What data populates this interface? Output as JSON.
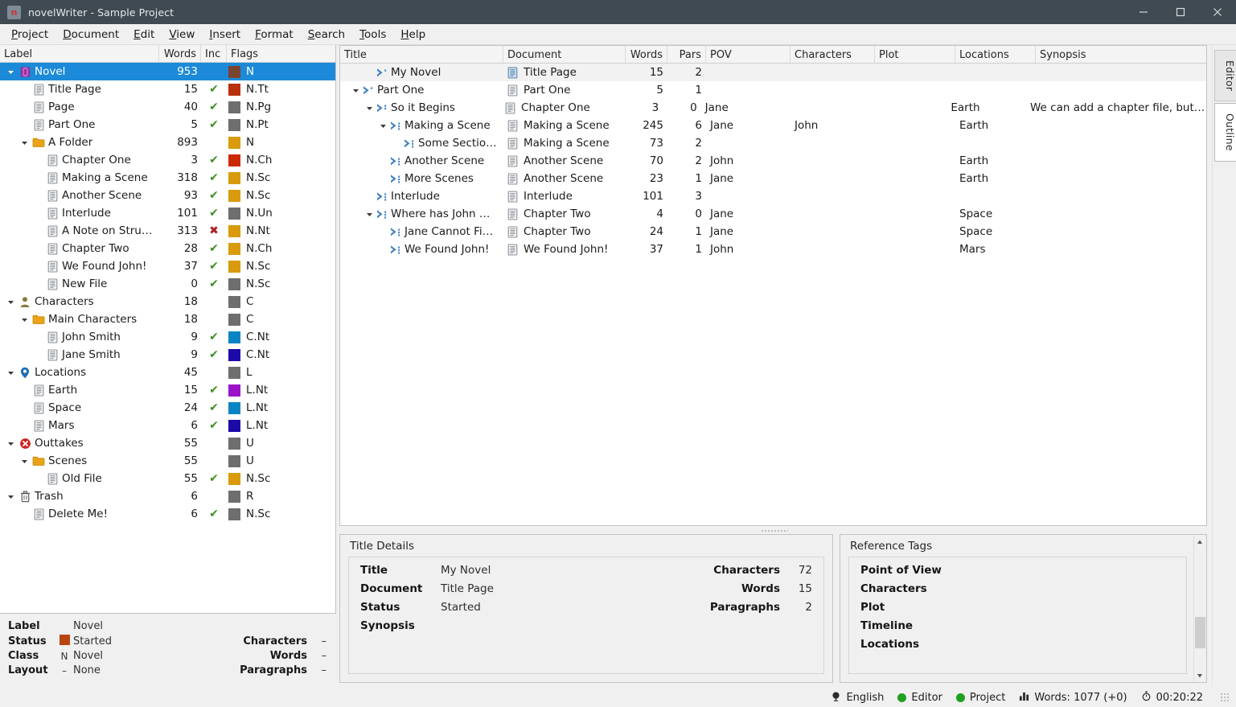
{
  "window": {
    "title": "novelWriter - Sample Project",
    "app_icon": "novelwriter-logo-icon",
    "minimize": "−",
    "maximize": "□",
    "close": "✕"
  },
  "menubar": {
    "items": [
      {
        "label": "Project",
        "mnemonic": "P"
      },
      {
        "label": "Document",
        "mnemonic": "D"
      },
      {
        "label": "Edit",
        "mnemonic": "E"
      },
      {
        "label": "View",
        "mnemonic": "V"
      },
      {
        "label": "Insert",
        "mnemonic": "I"
      },
      {
        "label": "Format",
        "mnemonic": "F"
      },
      {
        "label": "Search",
        "mnemonic": "S"
      },
      {
        "label": "Tools",
        "mnemonic": "T"
      },
      {
        "label": "Help",
        "mnemonic": "H"
      }
    ]
  },
  "project_tree": {
    "columns": [
      "Label",
      "Words",
      "Inc",
      "Flags"
    ],
    "rows": [
      {
        "label": "Novel",
        "words": "953",
        "inc": "",
        "flag_color": "#7a4530",
        "flags": "N",
        "depth": 0,
        "icon": "book-icon",
        "twisty": "open",
        "selected": true
      },
      {
        "label": "Title Page",
        "words": "15",
        "inc": "✔",
        "flag_color": "#b8300b",
        "flags": "N.Tt",
        "depth": 1,
        "icon": "document-icon",
        "twisty": "none"
      },
      {
        "label": "Page",
        "words": "40",
        "inc": "✔",
        "flag_color": "#6e6e6e",
        "flags": "N.Pg",
        "depth": 1,
        "icon": "document-icon",
        "twisty": "none"
      },
      {
        "label": "Part One",
        "words": "5",
        "inc": "✔",
        "flag_color": "#6e6e6e",
        "flags": "N.Pt",
        "depth": 1,
        "icon": "document-icon",
        "twisty": "none"
      },
      {
        "label": "A Folder",
        "words": "893",
        "inc": "",
        "flag_color": "#d99b0c",
        "flags": "N",
        "depth": 1,
        "icon": "folder-icon",
        "twisty": "open"
      },
      {
        "label": "Chapter One",
        "words": "3",
        "inc": "✔",
        "flag_color": "#cc2a06",
        "flags": "N.Ch",
        "depth": 2,
        "icon": "document-icon",
        "twisty": "none"
      },
      {
        "label": "Making a Scene",
        "words": "318",
        "inc": "✔",
        "flag_color": "#d99b0c",
        "flags": "N.Sc",
        "depth": 2,
        "icon": "document-icon",
        "twisty": "none"
      },
      {
        "label": "Another Scene",
        "words": "93",
        "inc": "✔",
        "flag_color": "#d99b0c",
        "flags": "N.Sc",
        "depth": 2,
        "icon": "document-icon",
        "twisty": "none"
      },
      {
        "label": "Interlude",
        "words": "101",
        "inc": "✔",
        "flag_color": "#6e6e6e",
        "flags": "N.Un",
        "depth": 2,
        "icon": "document-icon",
        "twisty": "none"
      },
      {
        "label": "A Note on Stru…",
        "words": "313",
        "inc": "✖",
        "flag_color": "#d99b0c",
        "flags": "N.Nt",
        "depth": 2,
        "icon": "document-icon",
        "twisty": "none"
      },
      {
        "label": "Chapter Two",
        "words": "28",
        "inc": "✔",
        "flag_color": "#d99b0c",
        "flags": "N.Ch",
        "depth": 2,
        "icon": "document-icon",
        "twisty": "none"
      },
      {
        "label": "We Found John!",
        "words": "37",
        "inc": "✔",
        "flag_color": "#d99b0c",
        "flags": "N.Sc",
        "depth": 2,
        "icon": "document-icon",
        "twisty": "none"
      },
      {
        "label": "New File",
        "words": "0",
        "inc": "✔",
        "flag_color": "#6e6e6e",
        "flags": "N.Sc",
        "depth": 2,
        "icon": "document-icon",
        "twisty": "none"
      },
      {
        "label": "Characters",
        "words": "18",
        "inc": "",
        "flag_color": "#6e6e6e",
        "flags": "C",
        "depth": 0,
        "icon": "person-icon",
        "twisty": "open"
      },
      {
        "label": "Main Characters",
        "words": "18",
        "inc": "",
        "flag_color": "#6e6e6e",
        "flags": "C",
        "depth": 1,
        "icon": "folder-icon",
        "twisty": "open"
      },
      {
        "label": "John Smith",
        "words": "9",
        "inc": "✔",
        "flag_color": "#0a85c4",
        "flags": "C.Nt",
        "depth": 2,
        "icon": "document-icon",
        "twisty": "none"
      },
      {
        "label": "Jane Smith",
        "words": "9",
        "inc": "✔",
        "flag_color": "#1c09a8",
        "flags": "C.Nt",
        "depth": 2,
        "icon": "document-icon",
        "twisty": "none"
      },
      {
        "label": "Locations",
        "words": "45",
        "inc": "",
        "flag_color": "#6e6e6e",
        "flags": "L",
        "depth": 0,
        "icon": "pin-icon",
        "twisty": "open"
      },
      {
        "label": "Earth",
        "words": "15",
        "inc": "✔",
        "flag_color": "#9b13c9",
        "flags": "L.Nt",
        "depth": 1,
        "icon": "document-icon",
        "twisty": "none"
      },
      {
        "label": "Space",
        "words": "24",
        "inc": "✔",
        "flag_color": "#0a85c4",
        "flags": "L.Nt",
        "depth": 1,
        "icon": "document-icon",
        "twisty": "none"
      },
      {
        "label": "Mars",
        "words": "6",
        "inc": "✔",
        "flag_color": "#1c09a8",
        "flags": "L.Nt",
        "depth": 1,
        "icon": "document-icon",
        "twisty": "none"
      },
      {
        "label": "Outtakes",
        "words": "55",
        "inc": "",
        "flag_color": "#6e6e6e",
        "flags": "U",
        "depth": 0,
        "icon": "error-circle-icon",
        "twisty": "open"
      },
      {
        "label": "Scenes",
        "words": "55",
        "inc": "",
        "flag_color": "#6e6e6e",
        "flags": "U",
        "depth": 1,
        "icon": "folder-icon",
        "twisty": "open"
      },
      {
        "label": "Old File",
        "words": "55",
        "inc": "✔",
        "flag_color": "#d99b0c",
        "flags": "N.Sc",
        "depth": 2,
        "icon": "document-icon",
        "twisty": "none"
      },
      {
        "label": "Trash",
        "words": "6",
        "inc": "",
        "flag_color": "#6e6e6e",
        "flags": "R",
        "depth": 0,
        "icon": "trash-icon",
        "twisty": "open"
      },
      {
        "label": "Delete Me!",
        "words": "6",
        "inc": "✔",
        "flag_color": "#6e6e6e",
        "flags": "N.Sc",
        "depth": 1,
        "icon": "document-icon",
        "twisty": "none"
      }
    ]
  },
  "item_details": {
    "label_key": "Label",
    "label_value": "Novel",
    "status_key": "Status",
    "status_value": "Started",
    "status_color": "#b8450f",
    "class_key": "Class",
    "class_mark": "N",
    "class_value": "Novel",
    "layout_key": "Layout",
    "layout_mark": "–",
    "layout_value": "None",
    "characters_key": "Characters",
    "characters_value": "–",
    "words_key": "Words",
    "words_value": "–",
    "paragraphs_key": "Paragraphs",
    "paragraphs_value": "–"
  },
  "outline": {
    "columns": [
      "Title",
      "Document",
      "Words",
      "Pars",
      "POV",
      "Characters",
      "Plot",
      "Locations",
      "Synopsis"
    ],
    "rows": [
      {
        "title": "My Novel",
        "level": 1,
        "depth": 1,
        "twisty": "none",
        "document": "Title Page",
        "words": "15",
        "pars": "2",
        "pov": "",
        "characters": "",
        "plot": "",
        "locations": "",
        "synopsis": "",
        "current": true
      },
      {
        "title": "Part One",
        "level": 1,
        "depth": 0,
        "twisty": "open",
        "document": "Part One",
        "words": "5",
        "pars": "1",
        "pov": "",
        "characters": "",
        "plot": "",
        "locations": "",
        "synopsis": ""
      },
      {
        "title": "So it Begins",
        "level": 2,
        "depth": 1,
        "twisty": "open",
        "document": "Chapter One",
        "words": "3",
        "pars": "0",
        "pov": "Jane",
        "characters": "",
        "plot": "",
        "locations": "Earth",
        "synopsis": "We can add a chapter file, but…"
      },
      {
        "title": "Making a Scene",
        "level": 3,
        "depth": 2,
        "twisty": "open",
        "document": "Making a Scene",
        "words": "245",
        "pars": "6",
        "pov": "Jane",
        "characters": "John",
        "plot": "",
        "locations": "Earth",
        "synopsis": ""
      },
      {
        "title": "Some Sectio…",
        "level": 3,
        "depth": 3,
        "twisty": "none",
        "document": "Making a Scene",
        "words": "73",
        "pars": "2",
        "pov": "",
        "characters": "",
        "plot": "",
        "locations": "",
        "synopsis": ""
      },
      {
        "title": "Another Scene",
        "level": 3,
        "depth": 2,
        "twisty": "none",
        "document": "Another Scene",
        "words": "70",
        "pars": "2",
        "pov": "John",
        "characters": "",
        "plot": "",
        "locations": "Earth",
        "synopsis": ""
      },
      {
        "title": "More Scenes",
        "level": 3,
        "depth": 2,
        "twisty": "none",
        "document": "Another Scene",
        "words": "23",
        "pars": "1",
        "pov": "Jane",
        "characters": "",
        "plot": "",
        "locations": "Earth",
        "synopsis": ""
      },
      {
        "title": "Interlude",
        "level": 3,
        "depth": 1,
        "twisty": "none",
        "document": "Interlude",
        "words": "101",
        "pars": "3",
        "pov": "",
        "characters": "",
        "plot": "",
        "locations": "",
        "synopsis": ""
      },
      {
        "title": "Where has John …",
        "level": 3,
        "depth": 1,
        "twisty": "open",
        "document": "Chapter Two",
        "words": "4",
        "pars": "0",
        "pov": "Jane",
        "characters": "",
        "plot": "",
        "locations": "Space",
        "synopsis": ""
      },
      {
        "title": "Jane Cannot Fi…",
        "level": 3,
        "depth": 2,
        "twisty": "none",
        "document": "Chapter Two",
        "words": "24",
        "pars": "1",
        "pov": "Jane",
        "characters": "",
        "plot": "",
        "locations": "Space",
        "synopsis": ""
      },
      {
        "title": "We Found John!",
        "level": 3,
        "depth": 2,
        "twisty": "none",
        "document": "We Found John!",
        "words": "37",
        "pars": "1",
        "pov": "John",
        "characters": "",
        "plot": "",
        "locations": "Mars",
        "synopsis": ""
      }
    ]
  },
  "title_details": {
    "panel_title": "Title Details",
    "rows": [
      {
        "key": "Title",
        "value": "My Novel"
      },
      {
        "key": "Document",
        "value": "Title Page"
      },
      {
        "key": "Status",
        "value": "Started"
      },
      {
        "key": "Synopsis",
        "value": ""
      }
    ],
    "stats": [
      {
        "key": "Characters",
        "value": "72"
      },
      {
        "key": "Words",
        "value": "15"
      },
      {
        "key": "Paragraphs",
        "value": "2"
      }
    ]
  },
  "reference_tags": {
    "panel_title": "Reference Tags",
    "items": [
      "Point of View",
      "Characters",
      "Plot",
      "Timeline",
      "Locations"
    ]
  },
  "rail": {
    "tabs": [
      {
        "label": "Editor",
        "active": false
      },
      {
        "label": "Outline",
        "active": true
      }
    ]
  },
  "statusbar": {
    "language": "English",
    "editor": "Editor",
    "project": "Project",
    "words": "Words: 1077 (+0)",
    "time": "00:20:22",
    "language_icon": "globe-icon",
    "stats_icon": "bar-chart-icon",
    "clock_icon": "stopwatch-icon",
    "ok_color": "#1fa01f"
  }
}
